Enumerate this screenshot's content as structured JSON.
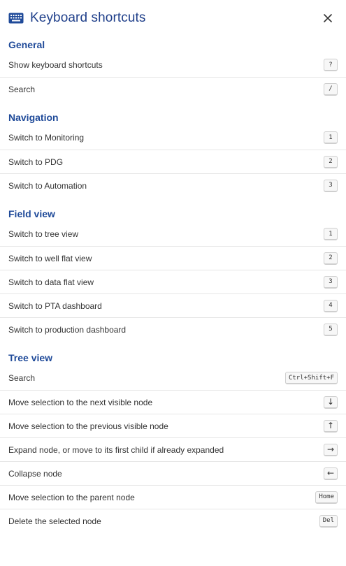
{
  "header": {
    "title": "Keyboard shortcuts",
    "icon": "keyboard-icon",
    "close_icon": "close-icon",
    "accent_color": "#1f4a99"
  },
  "sections": [
    {
      "title": "General",
      "items": [
        {
          "label": "Show keyboard shortcuts",
          "key": "?"
        },
        {
          "label": "Search",
          "key": "/"
        }
      ]
    },
    {
      "title": "Navigation",
      "items": [
        {
          "label": "Switch to Monitoring",
          "key": "1"
        },
        {
          "label": "Switch to PDG",
          "key": "2"
        },
        {
          "label": "Switch to Automation",
          "key": "3"
        }
      ]
    },
    {
      "title": "Field view",
      "items": [
        {
          "label": "Switch to tree view",
          "key": "1"
        },
        {
          "label": "Switch to well flat view",
          "key": "2"
        },
        {
          "label": "Switch to data flat view",
          "key": "3"
        },
        {
          "label": "Switch to PTA dashboard",
          "key": "4"
        },
        {
          "label": "Switch to production dashboard",
          "key": "5"
        }
      ]
    },
    {
      "title": "Tree view",
      "items": [
        {
          "label": "Search",
          "key": "Ctrl+Shift+F"
        },
        {
          "label": "Move selection to the next visible node",
          "key": "↓"
        },
        {
          "label": "Move selection to the previous visible node",
          "key": "↑"
        },
        {
          "label": "Expand node, or move to its first child if already expanded",
          "key": "→"
        },
        {
          "label": "Collapse node",
          "key": "←"
        },
        {
          "label": "Move selection to the parent node",
          "key": "Home"
        },
        {
          "label": "Delete the selected node",
          "key": "Del"
        }
      ]
    }
  ]
}
